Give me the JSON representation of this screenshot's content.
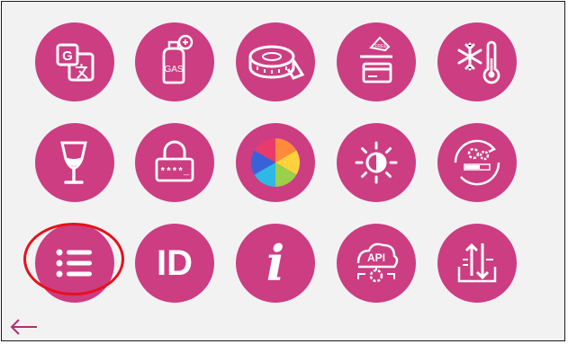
{
  "colors": {
    "tile": "#cc3d82",
    "icon": "#ffffff",
    "highlight": "#e8101c",
    "back": "#b0306c",
    "background": "#f2f2f2"
  },
  "tiles": [
    {
      "icon": "translate-icon",
      "text": "G"
    },
    {
      "icon": "gas-cylinder-icon",
      "text": "GAS"
    },
    {
      "icon": "measuring-tape-icon"
    },
    {
      "icon": "card-payment-icon",
      "text": "FREE"
    },
    {
      "icon": "snowflake-thermometer-icon"
    },
    {
      "icon": "wine-glass-icon"
    },
    {
      "icon": "password-lock-icon",
      "text": "****_"
    },
    {
      "icon": "color-wheel-icon"
    },
    {
      "icon": "brightness-icon"
    },
    {
      "icon": "refresh-settings-icon"
    },
    {
      "icon": "list-menu-icon"
    },
    {
      "icon": "id-icon",
      "text": "ID"
    },
    {
      "icon": "info-icon",
      "text": "i"
    },
    {
      "icon": "api-settings-icon",
      "text": "API"
    },
    {
      "icon": "transfer-arrows-icon"
    }
  ],
  "selected_tile": "list-menu-icon",
  "back": {
    "icon": "back-arrow-icon"
  }
}
